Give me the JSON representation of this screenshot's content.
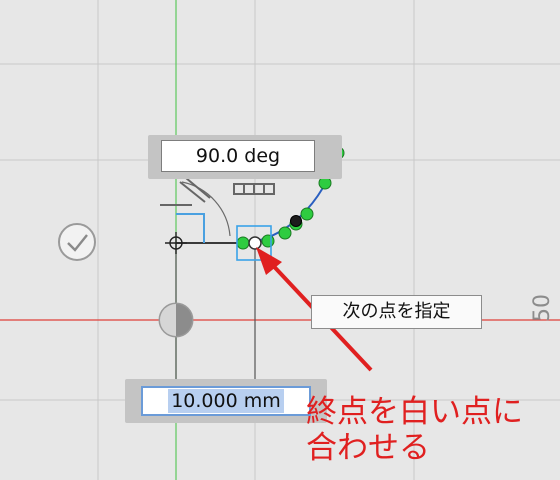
{
  "angle_dimension": {
    "value": "90.0 deg"
  },
  "length_dimension": {
    "value": "10.000 mm"
  },
  "tooltip": {
    "text": "次の点を指定"
  },
  "axis_tick_label": "50",
  "annotation": {
    "line1": "終点を白い点に",
    "line2": "合わせる"
  },
  "colors": {
    "background": "#e7e7e7",
    "grid": "#c8c8c8",
    "x_axis": "#e0403a",
    "y_axis": "#5ec95e",
    "arc": "#2a5fc0",
    "point_green": "#2ecc40",
    "annotation": "#e02020"
  },
  "icons": [
    "confirm-check-icon",
    "cursor-crosshair-icon",
    "snap-target-icon",
    "pen-tool-icon"
  ]
}
